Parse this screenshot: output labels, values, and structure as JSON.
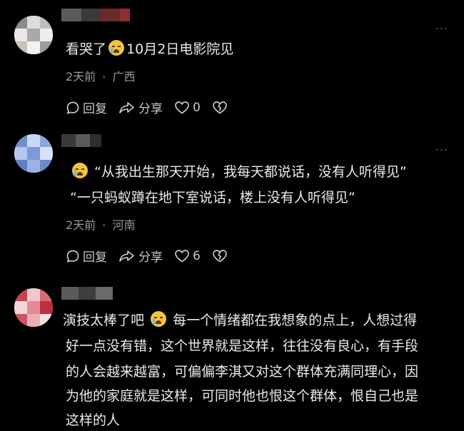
{
  "comments": [
    {
      "text_before": "看哭了",
      "text_after": "10月2日电影院见",
      "time": "2天前",
      "location": "广西",
      "reply_label": "回复",
      "share_label": "分享",
      "likes": "0"
    },
    {
      "line1": "“从我出生那天开始，我每天都说话，没有人听得见”",
      "line2": "“一只蚂蚁蹲在地下室说话，楼上没有人听得见”",
      "time": "2天前",
      "location": "河南",
      "reply_label": "回复",
      "share_label": "分享",
      "likes": "6"
    },
    {
      "line1_before": "演技太棒了吧",
      "line1_after": "每一个情绪都在我想象的点上，人想过得",
      "line2": "好一点没有错，这个世界就是这样，往往没有良心，有手段",
      "line3": "的人会越来越富，可偏偏李淇又对这个群体充满同理心，因",
      "line4": "为他的家庭就是这样，可同时他也恨这个群体，恨自己也是",
      "line5": "这样的人"
    }
  ],
  "meta_separator": "·",
  "more_icon": "..."
}
